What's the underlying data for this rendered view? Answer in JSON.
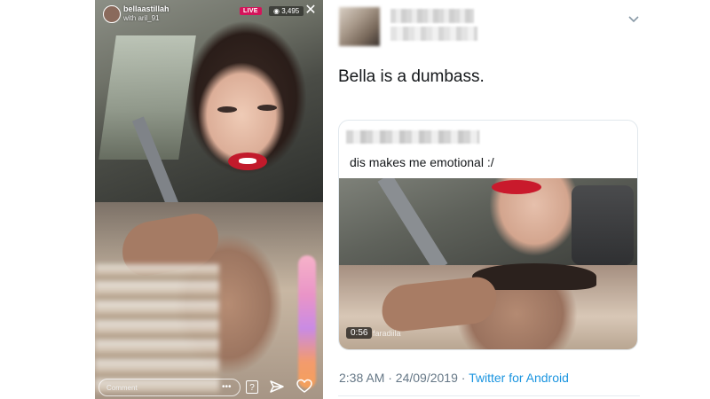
{
  "instagram_live": {
    "username": "bellaastillah",
    "with_user": "with aril_91",
    "live_badge": "LIVE",
    "viewer_count": "3,495",
    "comment_placeholder": "Comment",
    "more_label": "•••",
    "close_icon": "close-icon",
    "qa_icon": "question-icon",
    "send_icon": "send-icon",
    "like_icon": "heart-icon",
    "live_color": "#d4145a"
  },
  "tweet": {
    "text": "Bella is a dumbass.",
    "quoted": {
      "text": "dis makes me emotional :/",
      "video_duration": "0:56",
      "watermark": "faradiila"
    },
    "timestamp": "2:38 AM · 24/09/2019 · ",
    "source": "Twitter for Android",
    "caret_icon": "chevron-down-icon",
    "link_color": "#1b95e0"
  }
}
